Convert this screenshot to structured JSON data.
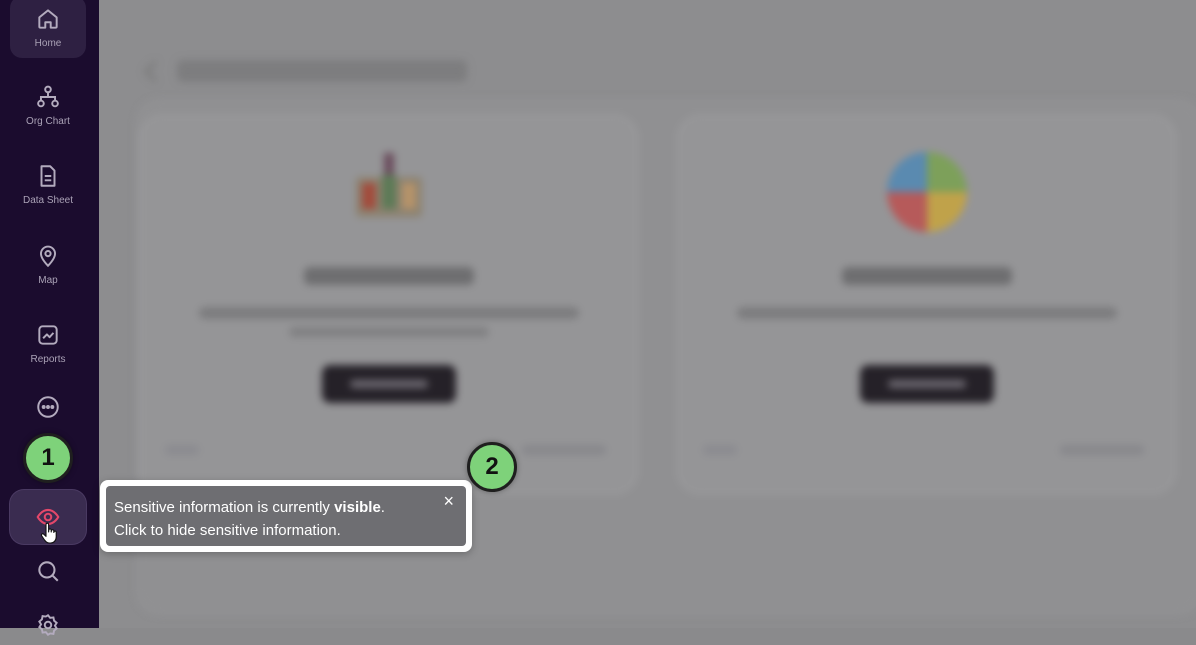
{
  "sidebar": {
    "items": [
      {
        "label": "Home",
        "icon": "home-icon"
      },
      {
        "label": "Org Chart",
        "icon": "org-chart-icon"
      },
      {
        "label": "Data Sheet",
        "icon": "document-icon"
      },
      {
        "label": "Map",
        "icon": "map-pin-icon"
      },
      {
        "label": "Reports",
        "icon": "reports-icon"
      },
      {
        "label": "",
        "icon": "more-icon"
      },
      {
        "label": "",
        "icon": "eye-icon"
      },
      {
        "label": "",
        "icon": "search-icon"
      },
      {
        "label": "",
        "icon": "settings-icon"
      }
    ]
  },
  "tooltip": {
    "text_before": "Sensitive information is currently ",
    "text_bold": "visible",
    "text_after": ".",
    "line2": "Click to hide sensitive information.",
    "close": "×"
  },
  "steps": {
    "one": "1",
    "two": "2"
  },
  "colors": {
    "sidebar_bg": "#1b0c2e",
    "eye_accent": "#e3476a",
    "step_green": "#7ed27a"
  }
}
